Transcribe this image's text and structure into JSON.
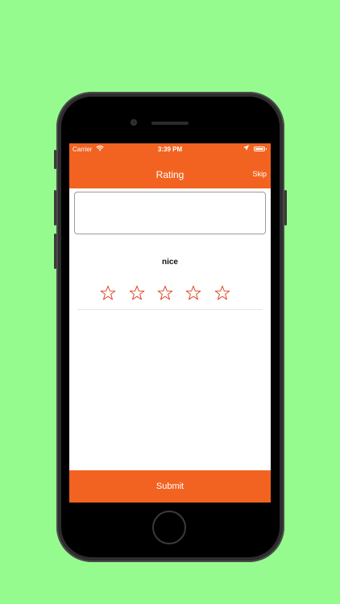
{
  "status_bar": {
    "carrier": "Carrier",
    "time": "3:39 PM"
  },
  "nav": {
    "title": "Rating",
    "skip_label": "Skip"
  },
  "review": {
    "value": "",
    "placeholder": ""
  },
  "rating": {
    "label": "nice",
    "stars_total": 5,
    "stars_filled": 0
  },
  "submit_label": "Submit",
  "colors": {
    "background": "#96fb8e",
    "accent": "#f26321",
    "star_outline": "#e4472a"
  }
}
